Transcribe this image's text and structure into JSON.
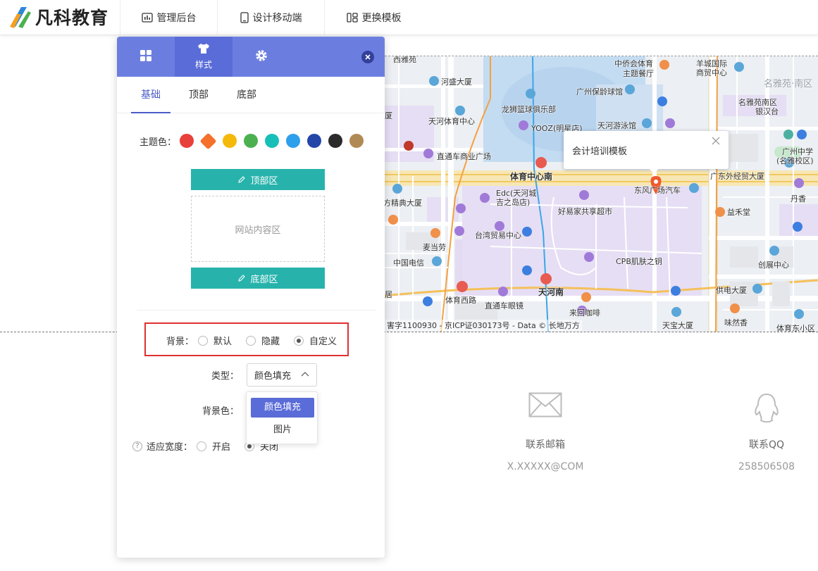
{
  "header": {
    "logo_text": "凡科教育",
    "nav": [
      {
        "label": "管理后台",
        "icon": "dashboard-icon"
      },
      {
        "label": "设计移动端",
        "icon": "mobile-icon"
      },
      {
        "label": "更换模板",
        "icon": "template-icon"
      }
    ]
  },
  "panel": {
    "tabs": [
      {
        "label": "",
        "icon": "grid-icon"
      },
      {
        "label": "样式",
        "icon": "shirt-icon",
        "active": true
      },
      {
        "label": "",
        "icon": "gear-icon"
      }
    ],
    "subtabs": [
      "基础",
      "顶部",
      "底部"
    ],
    "active_subtab": "基础",
    "theme_label": "主题色：",
    "theme_colors": [
      "#e8403a",
      "#f5702b",
      "#f5b90a",
      "#4cb050",
      "#17bfb8",
      "#2e9fea",
      "#2346a8",
      "#2b2b2b",
      "#b08a55"
    ],
    "top_area_label": "顶部区",
    "content_area_label": "网站内容区",
    "bottom_area_label": "底部区",
    "background": {
      "label": "背景：",
      "options": [
        "默认",
        "隐藏",
        "自定义"
      ],
      "selected": "自定义"
    },
    "type_label": "类型：",
    "type_value": "颜色填充",
    "type_options": [
      "颜色填充",
      "图片"
    ],
    "bg_color_label": "背景色：",
    "fit_width": {
      "label": "适应宽度：",
      "options": [
        "开启",
        "关闭"
      ],
      "selected": "关闭"
    }
  },
  "map": {
    "popup_title": "会计培训模板",
    "copyright": "害字1100930 - 京ICP证030173号 - Data © 长地万方",
    "labels": [
      "西雅苑",
      "天河体育中心",
      "龙狮篮球俱乐部",
      "广州保龄球馆",
      "中侨会体育",
      "主题餐厅",
      "羊城国际",
      "商贸中心",
      "名雅苑·南区",
      "名雅苑南区",
      "银汉台",
      "YOOZ(明星店)",
      "天河游泳馆",
      "直通车商业广场",
      "体育中心南",
      "广东外经贸大厦",
      "东风广场汽车",
      "广州中学",
      "(名雅校区)",
      "丹香",
      "Edc(天河城",
      "吉之岛店)",
      "好易家共享超市",
      "益禾堂",
      "方精典大厦",
      "台湾贸易中心",
      "麦当劳",
      "中国电信",
      "CPB肌肤之钥",
      "创展中心",
      "体育西路",
      "天河南",
      "直通车眼镜",
      "供电大厦",
      "来回咖啡",
      "味然香",
      "天宝大厦",
      "体育东小区",
      "居",
      "厦",
      "河盛大厦"
    ]
  },
  "contact": [
    {
      "label": "联系邮箱",
      "value": "X.XXXXX@COM",
      "icon": "mail-icon"
    },
    {
      "label": "联系QQ",
      "value": "258506508",
      "icon": "qq-icon"
    }
  ]
}
